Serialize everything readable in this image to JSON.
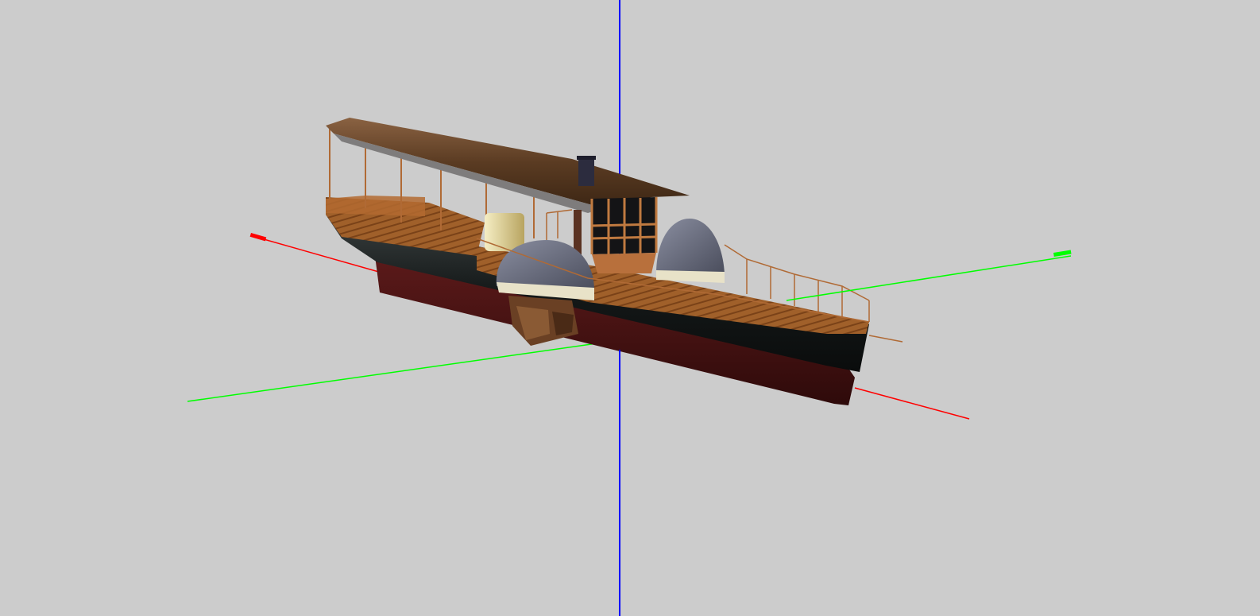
{
  "viewer": {
    "background_color": "#cccccc",
    "axes": {
      "x_axis_color": "#ff0000",
      "y_axis_color": "#00ff00",
      "z_axis_color": "#0000ff"
    },
    "model": {
      "subject": "paddle-steamer-boat",
      "colors": {
        "roof_wood": "#6b4a2e",
        "deck_wood": "#a0602a",
        "railing_copper": "#b06a35",
        "hull_black": "#1a1e1e",
        "hull_lower_red": "#4a1414",
        "paddle_box_gray": "#6f7385",
        "paddle_box_trim": "#e8e2c8",
        "cabin_glass": "#141416",
        "funnel": "#2c2c3e",
        "brass_cylinder": "#e3d49a"
      }
    }
  }
}
